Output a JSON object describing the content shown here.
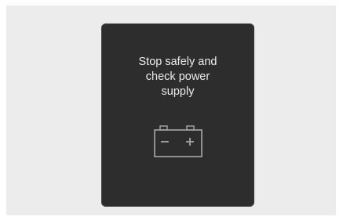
{
  "display": {
    "message": "Stop safely and check power supply",
    "icon": "battery-warning-icon"
  },
  "colors": {
    "screen_background": "#2d2d2d",
    "text": "#ececec",
    "icon_stroke": "#9a9a9a",
    "frame": "#ececec"
  }
}
